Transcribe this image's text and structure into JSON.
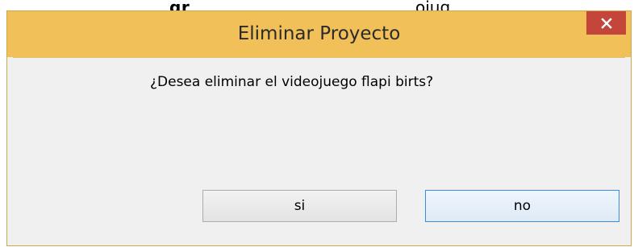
{
  "background": {
    "fragment_bold": "gr",
    "fragment_plain": "ojug"
  },
  "dialog": {
    "title": "Eliminar Proyecto",
    "close_icon": "close-icon",
    "message": "¿Desea eliminar el videojuego flapi birts?",
    "buttons": {
      "yes_label": "si",
      "no_label": "no"
    }
  },
  "colors": {
    "titlebar": "#f1c058",
    "close_button": "#c4463b",
    "focus_border": "#3c8be0"
  }
}
